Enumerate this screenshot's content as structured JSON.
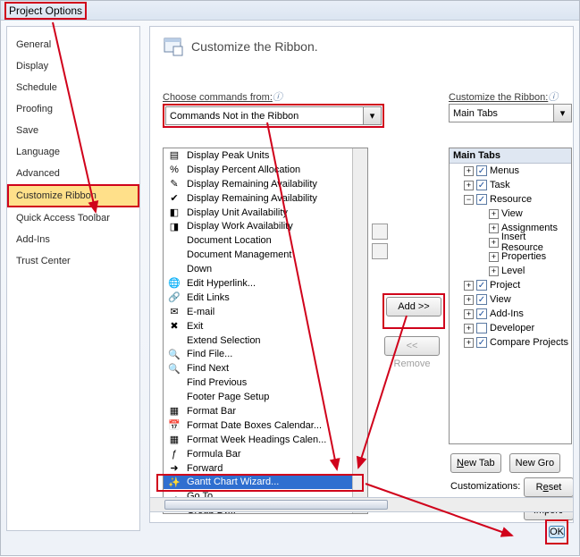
{
  "window": {
    "title": "Project Options"
  },
  "categories": [
    {
      "label": "General"
    },
    {
      "label": "Display"
    },
    {
      "label": "Schedule"
    },
    {
      "label": "Proofing"
    },
    {
      "label": "Save"
    },
    {
      "label": "Language"
    },
    {
      "label": "Advanced"
    },
    {
      "label": "Customize Ribbon",
      "selected": true
    },
    {
      "label": "Quick Access Toolbar"
    },
    {
      "label": "Add-Ins"
    },
    {
      "label": "Trust Center"
    }
  ],
  "panel": {
    "title": "Customize the Ribbon.",
    "choose_label": "Choose commands from:",
    "choose_value": "Commands Not in the Ribbon",
    "customize_label": "Customize the Ribbon:",
    "customize_value": "Main Tabs"
  },
  "commands": [
    {
      "label": "Display Peak Units",
      "icon": "bars"
    },
    {
      "label": "Display Percent Allocation",
      "icon": "percent"
    },
    {
      "label": "Display Remaining Availability",
      "icon": "pen"
    },
    {
      "label": "Display Remaining Availability",
      "icon": "check"
    },
    {
      "label": "Display Unit Availability",
      "icon": "units"
    },
    {
      "label": "Display Work Availability",
      "icon": "work"
    },
    {
      "label": "Document Location",
      "icon": ""
    },
    {
      "label": "Document Management",
      "icon": ""
    },
    {
      "label": "Down",
      "icon": ""
    },
    {
      "label": "Edit Hyperlink...",
      "icon": "globe"
    },
    {
      "label": "Edit Links",
      "icon": "link"
    },
    {
      "label": "E-mail",
      "icon": "mail"
    },
    {
      "label": "Exit",
      "icon": "x"
    },
    {
      "label": "Extend Selection",
      "icon": ""
    },
    {
      "label": "Find File...",
      "icon": "find"
    },
    {
      "label": "Find Next",
      "icon": "find"
    },
    {
      "label": "Find Previous",
      "icon": ""
    },
    {
      "label": "Footer Page Setup",
      "icon": ""
    },
    {
      "label": "Format Bar",
      "icon": "fmt"
    },
    {
      "label": "Format Date Boxes Calendar...",
      "icon": "cal"
    },
    {
      "label": "Format Week Headings Calen...",
      "icon": "fmt"
    },
    {
      "label": "Formula Bar",
      "icon": "fx"
    },
    {
      "label": "Forward",
      "icon": "fwd"
    },
    {
      "label": "Gantt Chart Wizard...",
      "icon": "wiz",
      "selected": true
    },
    {
      "label": "Go To...",
      "icon": "goto"
    },
    {
      "label": "Group By...",
      "icon": "grp"
    }
  ],
  "buttons": {
    "add": "Add >>",
    "remove": "<< Remove",
    "new_tab": "New Tab",
    "new_group": "New Gro",
    "reset": "Reset",
    "import": "Import/",
    "customizations_label": "Customizations:",
    "ok": "OK"
  },
  "tree": {
    "header": "Main Tabs",
    "nodes": [
      {
        "exp": "+",
        "chk": true,
        "label": "Menus",
        "ind": 1
      },
      {
        "exp": "+",
        "chk": true,
        "label": "Task",
        "ind": 1
      },
      {
        "exp": "-",
        "chk": true,
        "label": "Resource",
        "ind": 1
      },
      {
        "exp": "+",
        "label": "View",
        "ind": 2
      },
      {
        "exp": "+",
        "label": "Assignments",
        "ind": 2
      },
      {
        "exp": "+",
        "label": "Insert Resource",
        "ind": 2
      },
      {
        "exp": "+",
        "label": "Properties",
        "ind": 2
      },
      {
        "exp": "+",
        "label": "Level",
        "ind": 2
      },
      {
        "exp": "+",
        "chk": true,
        "label": "Project",
        "ind": 1
      },
      {
        "exp": "+",
        "chk": true,
        "label": "View",
        "ind": 1
      },
      {
        "exp": "+",
        "chk": true,
        "label": "Add-Ins",
        "ind": 1
      },
      {
        "exp": "+",
        "chk": false,
        "label": "Developer",
        "ind": 1
      },
      {
        "exp": "+",
        "chk": true,
        "label": "Compare Projects",
        "ind": 1
      }
    ]
  }
}
